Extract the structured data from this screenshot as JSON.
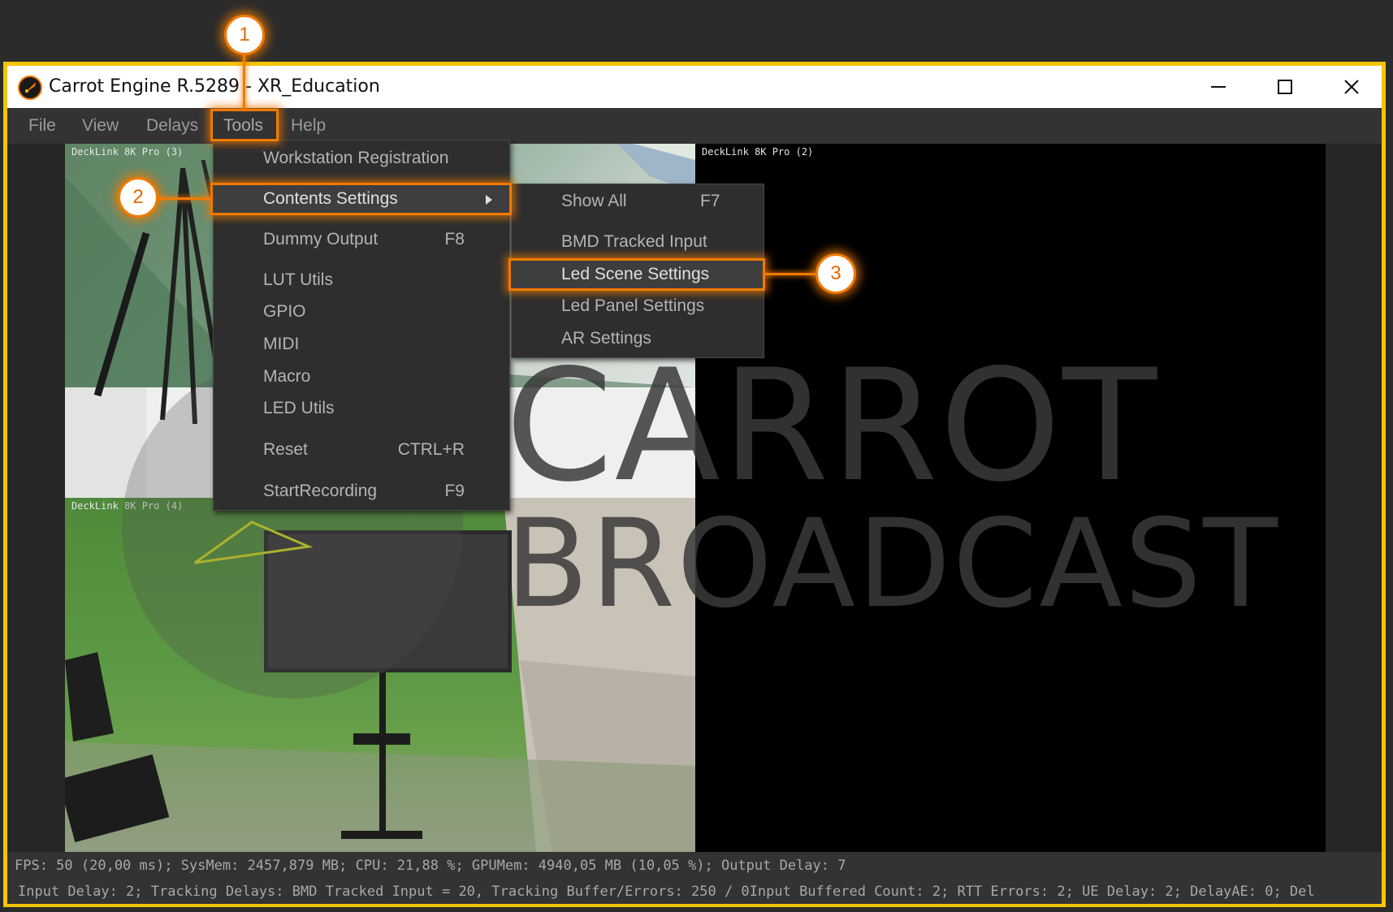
{
  "window": {
    "title": "Carrot Engine R.5289 - XR_Education",
    "controls": {
      "minimize": "minimize-icon",
      "maximize": "maximize-icon",
      "close": "close-icon"
    }
  },
  "menubar": {
    "items": [
      "File",
      "View",
      "Delays",
      "Tools",
      "Help"
    ]
  },
  "feeds": {
    "top_left": "DeckLink 8K Pro (3)",
    "top_right": "DeckLink 8K Pro (2)",
    "bottom_left": "DeckLink 8K Pro (4)"
  },
  "watermark": {
    "line1": "CARROT",
    "line2": "BROADCAST"
  },
  "tools_menu": {
    "items": [
      {
        "label": "Workstation Registration",
        "shortcut": ""
      },
      {
        "label": "Contents Settings",
        "shortcut": ""
      },
      {
        "label": "Dummy Output",
        "shortcut": "F8"
      },
      {
        "label": "LUT Utils",
        "shortcut": ""
      },
      {
        "label": "GPIO",
        "shortcut": ""
      },
      {
        "label": "MIDI",
        "shortcut": ""
      },
      {
        "label": "Macro",
        "shortcut": ""
      },
      {
        "label": "LED Utils",
        "shortcut": ""
      },
      {
        "label": "Reset",
        "shortcut": "CTRL+R"
      },
      {
        "label": "StartRecording",
        "shortcut": "F9"
      }
    ]
  },
  "contents_submenu": {
    "items": [
      {
        "label": "Show All",
        "shortcut": "F7"
      },
      {
        "label": "BMD Tracked Input",
        "shortcut": ""
      },
      {
        "label": "Led Scene Settings",
        "shortcut": ""
      },
      {
        "label": "Led Panel Settings",
        "shortcut": ""
      },
      {
        "label": "AR Settings",
        "shortcut": ""
      }
    ]
  },
  "callouts": [
    "1",
    "2",
    "3"
  ],
  "statusbar": {
    "line1": "FPS: 50 (20,00 ms); SysMem: 2457,879 MB; CPU: 21,88 %; GPUMem: 4940,05 MB (10,05 %);   Output Delay: 7",
    "line2": "Input Delay: 2; Tracking Delays: BMD Tracked Input = 20, Tracking Buffer/Errors: 250 / 0Input Buffered Count: 2; RTT Errors: 2; UE Delay: 2; DelayAE: 0; Del"
  },
  "colors": {
    "window_border": "#f5c400",
    "highlight": "#f07a00",
    "menu_bg": "#2e2e2e",
    "menu_text": "#b4b4b4"
  }
}
